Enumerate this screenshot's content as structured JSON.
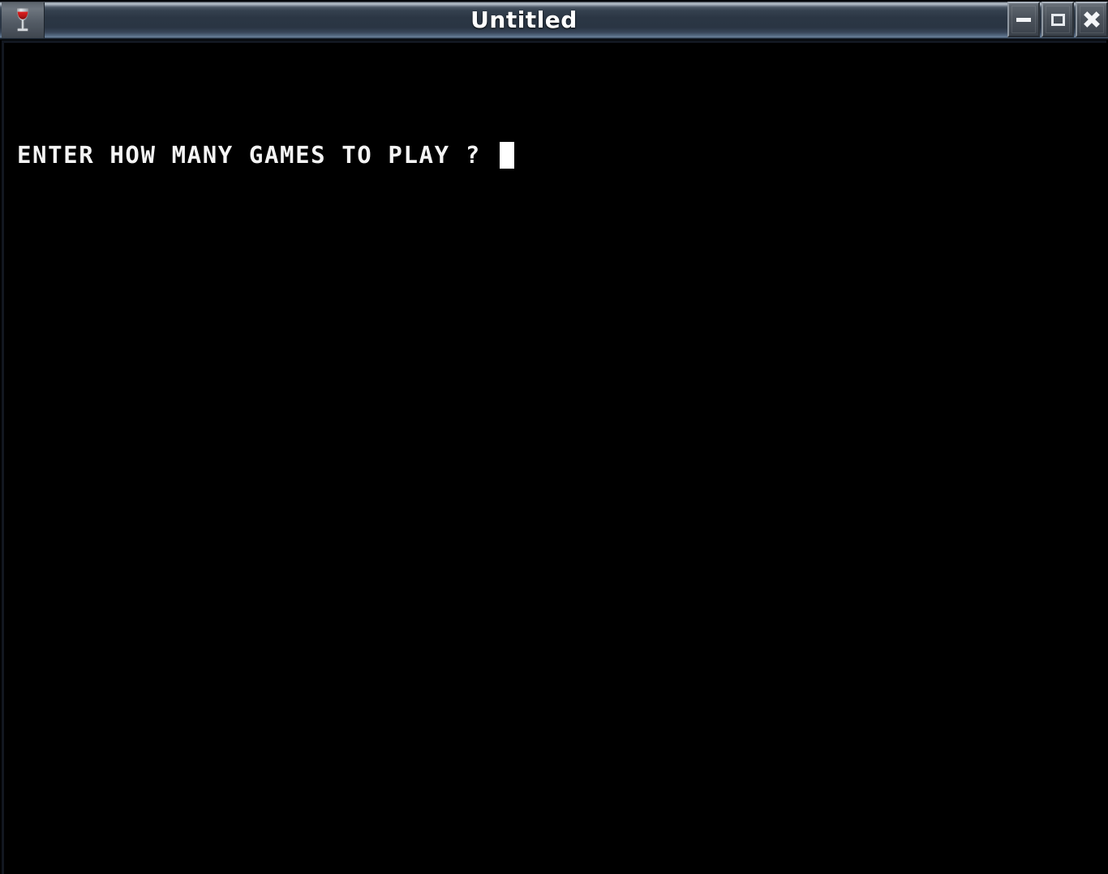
{
  "window": {
    "title": "Untitled",
    "icon": "wine-glass-icon",
    "frame_color": "#2a3543",
    "client_background": "#000000"
  },
  "titlebar": {
    "buttons": [
      {
        "name": "minimize-button",
        "glyph": "minimize-icon",
        "label": "Minimize"
      },
      {
        "name": "maximize-button",
        "glyph": "maximize-icon",
        "label": "Maximize"
      },
      {
        "name": "close-button",
        "glyph": "close-icon",
        "label": "Close"
      }
    ]
  },
  "terminal": {
    "foreground_color": "#f4f4f4",
    "background_color": "#000000",
    "lines": [
      {
        "text": "ENTER HOW MANY GAMES TO PLAY ? ",
        "has_cursor": true
      }
    ],
    "cursor": {
      "style": "block",
      "color": "#ffffff",
      "visible": true
    }
  }
}
